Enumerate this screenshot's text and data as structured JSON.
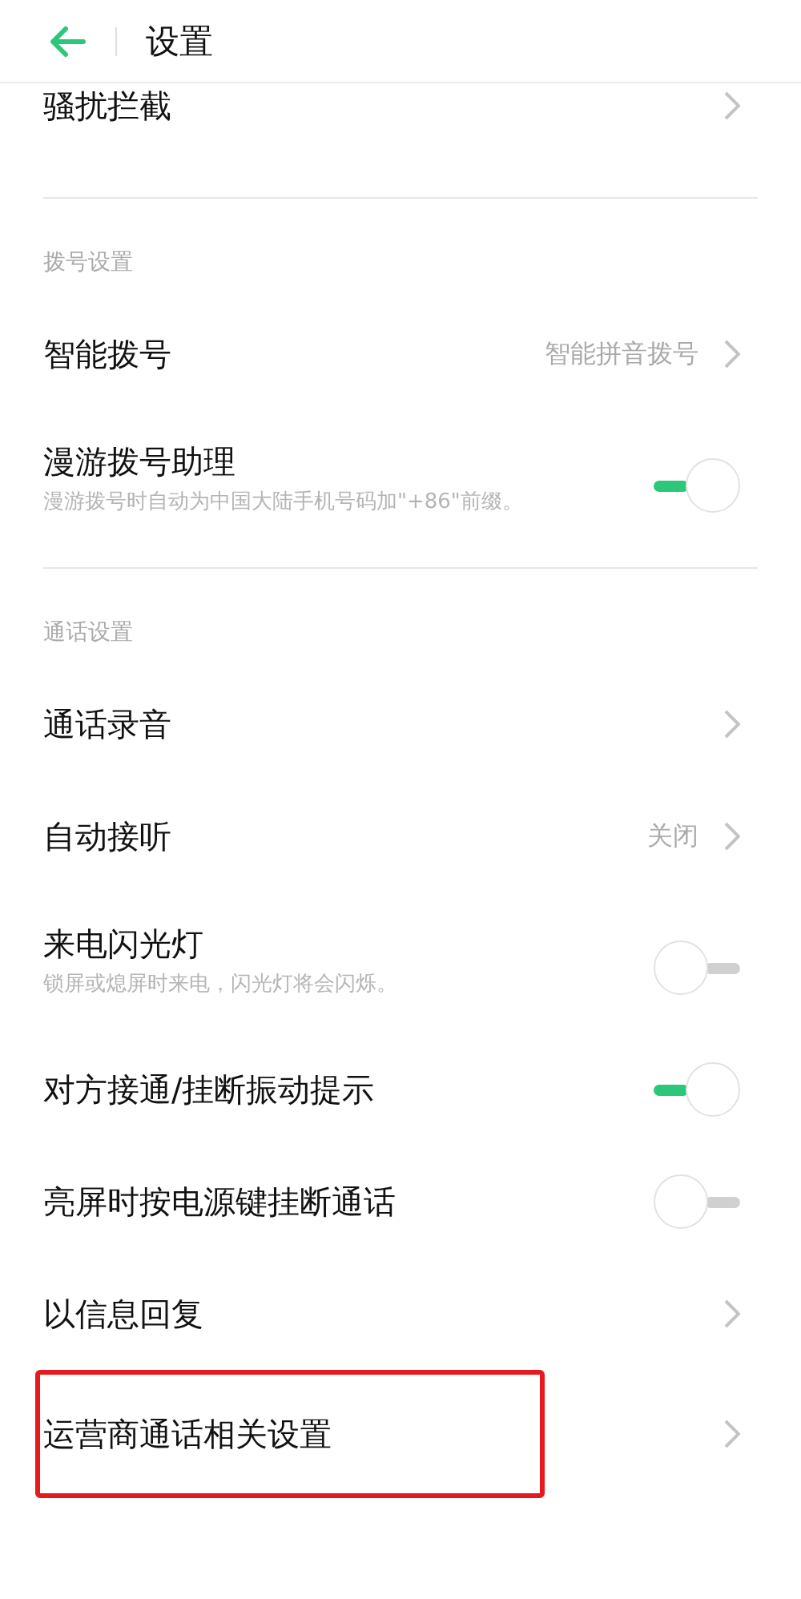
{
  "header": {
    "title": "设置"
  },
  "sections": [
    {
      "items": [
        {
          "kind": "link",
          "title": "骚扰拦截",
          "highlighted": false
        }
      ]
    },
    {
      "label": "拨号设置",
      "items": [
        {
          "kind": "link",
          "title": "智能拨号",
          "value": "智能拼音拨号",
          "highlighted": false
        },
        {
          "kind": "switch",
          "title": "漫游拨号助理",
          "subtitle": "漫游拨号时自动为中国大陆手机号码加\"+86\"前缀。",
          "on": true,
          "highlighted": false
        }
      ]
    },
    {
      "label": "通话设置",
      "items": [
        {
          "kind": "link",
          "title": "通话录音",
          "highlighted": false
        },
        {
          "kind": "link",
          "title": "自动接听",
          "value": "关闭",
          "highlighted": false
        },
        {
          "kind": "switch",
          "title": "来电闪光灯",
          "subtitle": "锁屏或熄屏时来电，闪光灯将会闪烁。",
          "on": false,
          "highlighted": false
        },
        {
          "kind": "switch",
          "title": "对方接通/挂断振动提示",
          "on": true,
          "highlighted": false
        },
        {
          "kind": "switch",
          "title": "亮屏时按电源键挂断通话",
          "on": false,
          "highlighted": false
        },
        {
          "kind": "link",
          "title": "以信息回复",
          "highlighted": false
        },
        {
          "kind": "link",
          "title": "运营商通话相关设置",
          "highlighted": true
        }
      ]
    }
  ]
}
